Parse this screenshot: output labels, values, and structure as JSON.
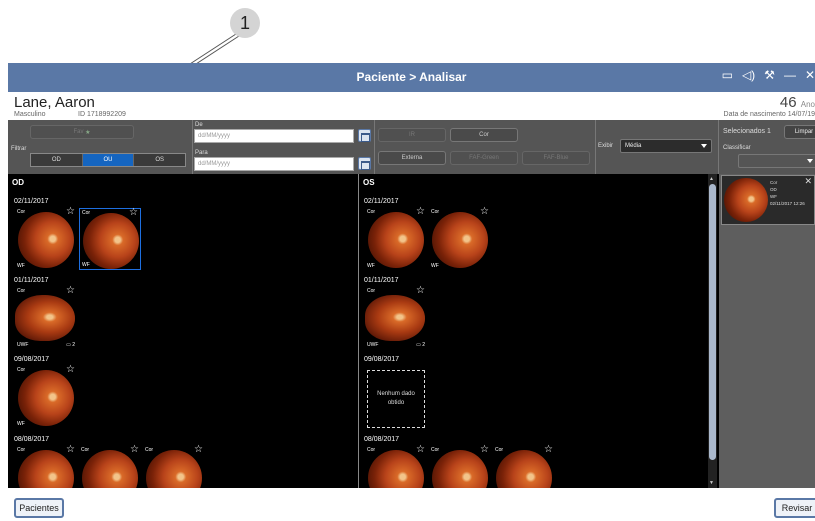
{
  "callout": {
    "number": "1"
  },
  "window": {
    "title": "Paciente > Analisar"
  },
  "patient": {
    "name": "Lane, Aaron",
    "sex": "Masculino",
    "id": "ID 1718992209",
    "age": "46",
    "age_unit": "Ano",
    "dob": "Data de nascimento  14/07/19"
  },
  "filter": {
    "label": "Filtrar",
    "fav_button": "Fav",
    "eye_segments": [
      "OD",
      "OU",
      "OS"
    ],
    "active_eye": "OU",
    "from_label": "De",
    "from_placeholder": "dd/MM/yyyy",
    "to_label": "Para",
    "to_placeholder": "dd/MM/yyyy",
    "type_buttons": {
      "ir": "IR",
      "cor": "Cor",
      "externa": "Externa",
      "faf_green": "FAF-Green",
      "faf_blue": "FAF-Blue"
    },
    "show_label": "Exibir",
    "show_value": "Média"
  },
  "od": {
    "title": "OD",
    "groups": [
      {
        "date": "02/11/2017",
        "thumbs": [
          {
            "type": "Cor",
            "mode": "WF",
            "selected": false
          },
          {
            "type": "Cor",
            "mode": "WF",
            "selected": true
          }
        ]
      },
      {
        "date": "01/11/2017",
        "thumbs": [
          {
            "type": "Cor",
            "mode": "UWF",
            "stack": "2"
          }
        ]
      },
      {
        "date": "09/08/2017",
        "thumbs": [
          {
            "type": "Cor",
            "mode": "WF"
          }
        ]
      },
      {
        "date": "08/08/2017",
        "thumbs": [
          {
            "type": "Cor"
          },
          {
            "type": "Cor"
          },
          {
            "type": "Cor"
          }
        ]
      }
    ]
  },
  "os": {
    "title": "OS",
    "groups": [
      {
        "date": "02/11/2017",
        "thumbs": [
          {
            "type": "Cor",
            "mode": "WF"
          },
          {
            "type": "Cor",
            "mode": "WF"
          }
        ]
      },
      {
        "date": "01/11/2017",
        "thumbs": [
          {
            "type": "Cor",
            "mode": "UWF",
            "stack": "2"
          }
        ]
      },
      {
        "date": "09/08/2017",
        "nodata": "Nenhum dado obtido"
      },
      {
        "date": "08/08/2017",
        "thumbs": [
          {
            "type": "Cor"
          },
          {
            "type": "Cor"
          },
          {
            "type": "Cor"
          }
        ]
      }
    ]
  },
  "side": {
    "selected_label": "Selecionados",
    "selected_count": "1",
    "clear_button": "Limpar",
    "sort_label": "Classificar",
    "item": {
      "type": "Cor",
      "eye": "OD",
      "mode": "WF",
      "datetime": "02/11/2017  12:26"
    }
  },
  "footer": {
    "patients_button": "Pacientes",
    "review_button": "Revisar"
  },
  "colors": {
    "titlebar": "#5a78a6",
    "active_segment": "#1565c0",
    "selection": "#1e6fe0"
  }
}
